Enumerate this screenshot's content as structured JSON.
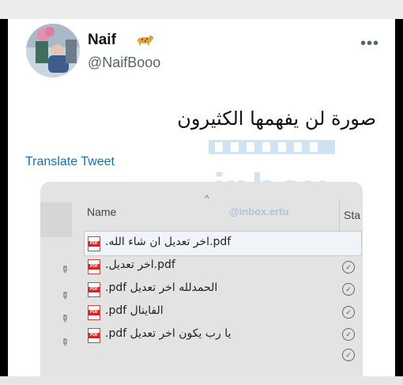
{
  "tweet": {
    "display_name": "Naif",
    "handle": "@NaifBooo",
    "more_label": "•••",
    "text": "صورة لن يفهمها الكثيرون",
    "translate_label": "Translate Tweet",
    "emoji": "leopard-emoji"
  },
  "watermark": {
    "text": "inbox",
    "handle": "@inbox.ertu"
  },
  "explorer": {
    "columns": [
      "Name",
      "Sta"
    ],
    "files": [
      {
        "name": ".اخر تعديل ان شاء الله.pdf",
        "status_icon": "check-circle-icon"
      },
      {
        "name": ".اخر تعديل.pdf",
        "status_icon": "check-circle-icon"
      },
      {
        "name": ".pdf الحمدلله اخر تعديل",
        "status_icon": "check-circle-icon"
      },
      {
        "name": ".pdf الفاينال",
        "status_icon": "check-circle-icon"
      },
      {
        "name": ".pdf يا رب يكون اخر تعديل",
        "status_icon": "check-circle-icon"
      }
    ]
  }
}
